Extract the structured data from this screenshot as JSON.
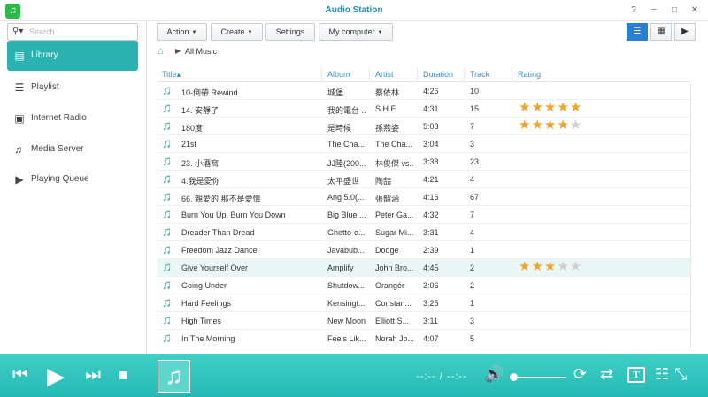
{
  "window": {
    "title": "Audio Station",
    "controls": [
      "?",
      "−",
      "□",
      "✕"
    ]
  },
  "search": {
    "placeholder": "Search",
    "value": ""
  },
  "sidebar": {
    "items": [
      {
        "label": "Library",
        "icon": "library-icon",
        "active": true
      },
      {
        "label": "Playlist",
        "icon": "playlist-icon",
        "active": false
      },
      {
        "label": "Internet Radio",
        "icon": "internet-radio-icon",
        "active": false
      },
      {
        "label": "Media Server",
        "icon": "media-server-icon",
        "active": false
      },
      {
        "label": "Playing Queue",
        "icon": "playing-queue-icon",
        "active": false
      }
    ]
  },
  "toolbar": {
    "action_label": "Action",
    "create_label": "Create",
    "settings_label": "Settings",
    "source_label": "My computer",
    "views": [
      "list-view-icon",
      "grid-view-icon",
      "player-view-icon"
    ],
    "active_view": 0
  },
  "breadcrumb": {
    "label": "All Music"
  },
  "table": {
    "columns": [
      "Title",
      "Album",
      "Artist",
      "Duration",
      "Track",
      "Rating"
    ],
    "sort_indicator": "▴",
    "rows": [
      {
        "title": "10-倒帶 Rewind",
        "album": "城堡",
        "artist": "蔡依林",
        "duration": "4:26",
        "track": "10",
        "rating": 0
      },
      {
        "title": "14. 安靜了",
        "album": "我的電台 ...",
        "artist": "S.H.E",
        "duration": "4:31",
        "track": "15",
        "rating": 5
      },
      {
        "title": "180度",
        "album": "是時候",
        "artist": "孫燕姿",
        "duration": "5:03",
        "track": "7",
        "rating": 4
      },
      {
        "title": "21st",
        "album": "The Cha...",
        "artist": "The Cha...",
        "duration": "3:04",
        "track": "3",
        "rating": 0
      },
      {
        "title": "23. 小酒窩",
        "album": "JJ陸(200...",
        "artist": "林俊傑 vs...",
        "duration": "3:38",
        "track": "23",
        "rating": 0
      },
      {
        "title": "4.我是愛你",
        "album": "太平盛世",
        "artist": "陶喆",
        "duration": "4:21",
        "track": "4",
        "rating": 0
      },
      {
        "title": "66. 親愛的 那不是愛情",
        "album": "Ang 5.0(...",
        "artist": "張韶涵",
        "duration": "4:16",
        "track": "67",
        "rating": 0
      },
      {
        "title": "Burn You Up, Burn You Down",
        "album": "Big Blue ...",
        "artist": "Peter Ga...",
        "duration": "4:32",
        "track": "7",
        "rating": 0
      },
      {
        "title": "Dreader Than Dread",
        "album": "Ghetto-o...",
        "artist": "Sugar Mi...",
        "duration": "3:31",
        "track": "4",
        "rating": 0
      },
      {
        "title": "Freedom Jazz Dance",
        "album": "Javabub...",
        "artist": "Dodge",
        "duration": "2:39",
        "track": "1",
        "rating": 0
      },
      {
        "title": "Give Yourself Over",
        "album": "Amplify",
        "artist": "John Bro...",
        "duration": "4:45",
        "track": "2",
        "rating": 3,
        "highlight": true
      },
      {
        "title": "Going Under",
        "album": "Shutdow...",
        "artist": "Orangér",
        "duration": "3:06",
        "track": "2",
        "rating": 0
      },
      {
        "title": "Hard Feelings",
        "album": "Kensingt...",
        "artist": "Constan...",
        "duration": "3:25",
        "track": "1",
        "rating": 0
      },
      {
        "title": "High Times",
        "album": "New Moon",
        "artist": "Elliott S...",
        "duration": "3:11",
        "track": "3",
        "rating": 0
      },
      {
        "title": "In The Morning",
        "album": "Feels Lik...",
        "artist": "Norah Jo...",
        "duration": "4:07",
        "track": "5",
        "rating": 0
      }
    ]
  },
  "player": {
    "time_display": "--:-- / --:--",
    "volume": 0.05,
    "accent": "#2ab3b0"
  }
}
